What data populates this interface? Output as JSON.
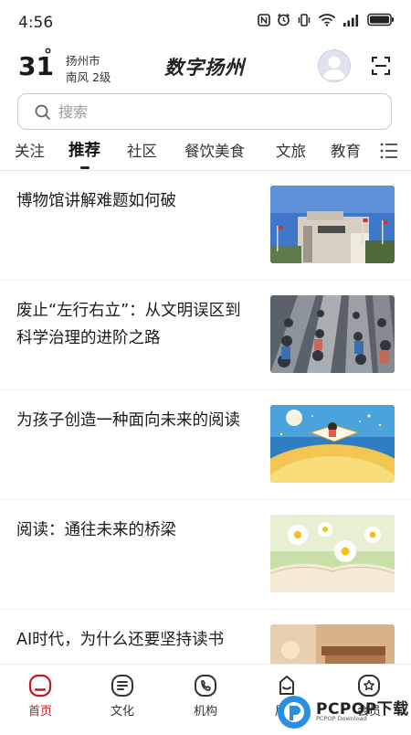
{
  "status_bar": {
    "time": "4:56",
    "icons": [
      "nfc-icon",
      "alarm-icon",
      "vibrate-icon",
      "wifi-icon",
      "signal-icon",
      "battery-icon"
    ]
  },
  "header": {
    "temperature": "31",
    "degree_symbol": "°",
    "city": "扬州市",
    "wind": "南风  2级",
    "brand": "数字扬州"
  },
  "search": {
    "placeholder": "搜索"
  },
  "tabs": [
    {
      "label": "关注",
      "active": false
    },
    {
      "label": "推荐",
      "active": true
    },
    {
      "label": "社区",
      "active": false
    },
    {
      "label": "餐饮美食",
      "active": false
    },
    {
      "label": "文旅",
      "active": false
    },
    {
      "label": "教育",
      "active": false
    }
  ],
  "articles": [
    {
      "title": "博物馆讲解难题如何破",
      "thumb": "museum-building"
    },
    {
      "title": "废止“左行右立”：从文明误区到科学治理的进阶之路",
      "thumb": "escalator-crowd"
    },
    {
      "title": "为孩子创造一种面向未来的阅读",
      "thumb": "child-reading-book"
    },
    {
      "title": "阅读：通往未来的桥梁",
      "thumb": "book-daisies"
    },
    {
      "title": "AI时代，为什么还要坚持读书",
      "thumb": "books-stack"
    }
  ],
  "bottom_nav": [
    {
      "label": "首页",
      "icon": "home-icon",
      "active": true
    },
    {
      "label": "文化",
      "icon": "culture-icon",
      "active": false
    },
    {
      "label": "机构",
      "icon": "institution-icon",
      "active": false
    },
    {
      "label": "居民",
      "icon": "resident-icon",
      "active": false
    },
    {
      "label": "会员",
      "icon": "member-icon",
      "active": false
    }
  ],
  "watermark": {
    "text": "PCPOP下载",
    "sub": "PCPOP Download"
  },
  "colors": {
    "accent": "#c8161d",
    "text": "#1a1a1a",
    "divider": "#efefef"
  }
}
